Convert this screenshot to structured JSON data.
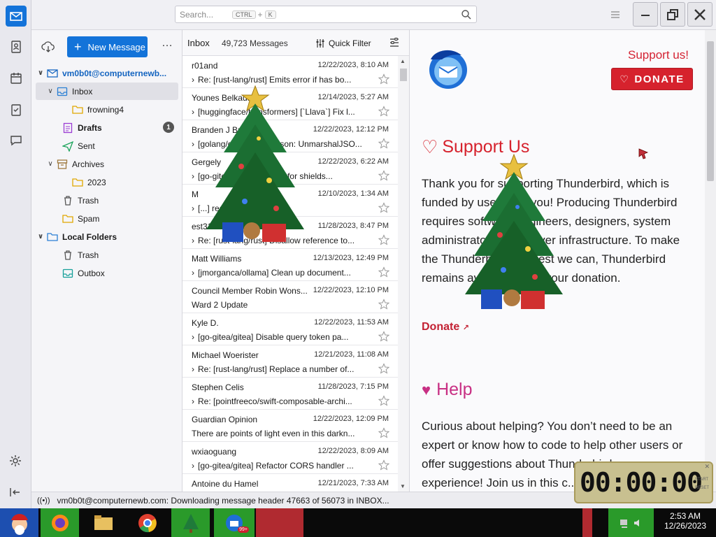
{
  "app": {
    "title": "Thunderbird"
  },
  "search": {
    "placeholder": "Search...",
    "key1": "CTRL",
    "plus": "+",
    "key2": "K"
  },
  "folder_pane": {
    "new_message": "New Message",
    "more": "…",
    "account": "vm0b0t@computernewb...",
    "folders": [
      {
        "label": "Inbox",
        "icon": "inbox-icon"
      },
      {
        "label": "frowning4",
        "icon": "folder-icon"
      },
      {
        "label": "Drafts",
        "icon": "drafts-icon",
        "badge": "1"
      },
      {
        "label": "Sent",
        "icon": "sent-icon"
      },
      {
        "label": "Archives",
        "icon": "archive-icon"
      },
      {
        "label": "2023",
        "icon": "folder-icon"
      },
      {
        "label": "Trash",
        "icon": "trash-icon"
      },
      {
        "label": "Spam",
        "icon": "folder-icon"
      },
      {
        "label": "Local Folders",
        "icon": "local-folders-icon"
      },
      {
        "label": "Trash",
        "icon": "trash-icon"
      },
      {
        "label": "Outbox",
        "icon": "outbox-icon"
      }
    ]
  },
  "message_list": {
    "title": "Inbox",
    "count": "49,723 Messages",
    "quick_filter": "Quick Filter",
    "messages": [
      {
        "from": "r01and",
        "date": "12/22/2023, 8:10 AM",
        "subject": "Re: [rust-lang/rust] Emits error if has bo..."
      },
      {
        "from": "Younes Belkada",
        "date": "12/14/2023, 5:27 AM",
        "subject": "[huggingface/transformers] [`Llava`] Fix l..."
      },
      {
        "from": "Branden J Brown",
        "date": "12/22/2023, 12:12 PM",
        "subject": "[golang/go] encoding/json: UnmarshalJSO..."
      },
      {
        "from": "Gergely",
        "date": "12/22/2023, 6:22 AM",
        "subject": "[go-gitea/gitea] Support for shields..."
      },
      {
        "from": "M",
        "date": "12/10/2023, 1:34 AM",
        "subject": "[...] readmes, r..."
      },
      {
        "from": "est31",
        "date": "11/28/2023, 8:47 PM",
        "subject": "Re: [rust-lang/rust] Disallow reference to..."
      },
      {
        "from": "Matt Williams",
        "date": "12/13/2023, 12:49 PM",
        "subject": "[jmorganca/ollama] Clean up document..."
      },
      {
        "from": "Council Member Robin Wons...",
        "date": "12/22/2023, 12:10 PM",
        "subject": "Ward 2 Update"
      },
      {
        "from": "Kyle D.",
        "date": "12/22/2023, 11:53 AM",
        "subject": "[go-gitea/gitea] Disable query token pa..."
      },
      {
        "from": "Michael Woerister",
        "date": "12/21/2023, 11:08 AM",
        "subject": "Re: [rust-lang/rust] Replace a number of..."
      },
      {
        "from": "Stephen Celis",
        "date": "11/28/2023, 7:15 PM",
        "subject": "Re: [pointfreeco/swift-composable-archi..."
      },
      {
        "from": "Guardian Opinion",
        "date": "12/22/2023, 12:09 PM",
        "subject": "There are points of light even in this darkn..."
      },
      {
        "from": "wxiaoguang",
        "date": "12/22/2023, 8:09 AM",
        "subject": "[go-gitea/gitea] Refactor CORS handler ..."
      },
      {
        "from": "Antoine du Hamel",
        "date": "12/21/2023, 7:33 AM",
        "subject": ""
      }
    ]
  },
  "reader": {
    "support_link": "Support us!",
    "donate_button": "DONATE",
    "support_heading": "Support Us",
    "support_text": "Thank you for supporting Thunderbird, which is funded by users like you! Producing Thunderbird requires software engineers, designers, system administrators and server infrastructure. To make the Thunderbird, the best we can, Thunderbird remains available is by your donation.",
    "donate_link": "Donate",
    "help_heading": "Help",
    "help_text": "Curious about helping? You don’t need to be an expert or know how to code to help other users or offer suggestions about Thunderbird user experience! Join us in this c..."
  },
  "status": {
    "text": "vm0b0t@computernewb.com: Downloading message header 47663 of 56073 in INBOX..."
  },
  "timer": {
    "display": "00:00:00",
    "start": "START",
    "reset": "RESET"
  },
  "taskbar": {
    "time": "2:53 AM",
    "date": "12/26/2023",
    "badge": "99+"
  },
  "colors": {
    "accent": "#1373d9",
    "donate": "#d6222d",
    "help": "#c83084"
  }
}
